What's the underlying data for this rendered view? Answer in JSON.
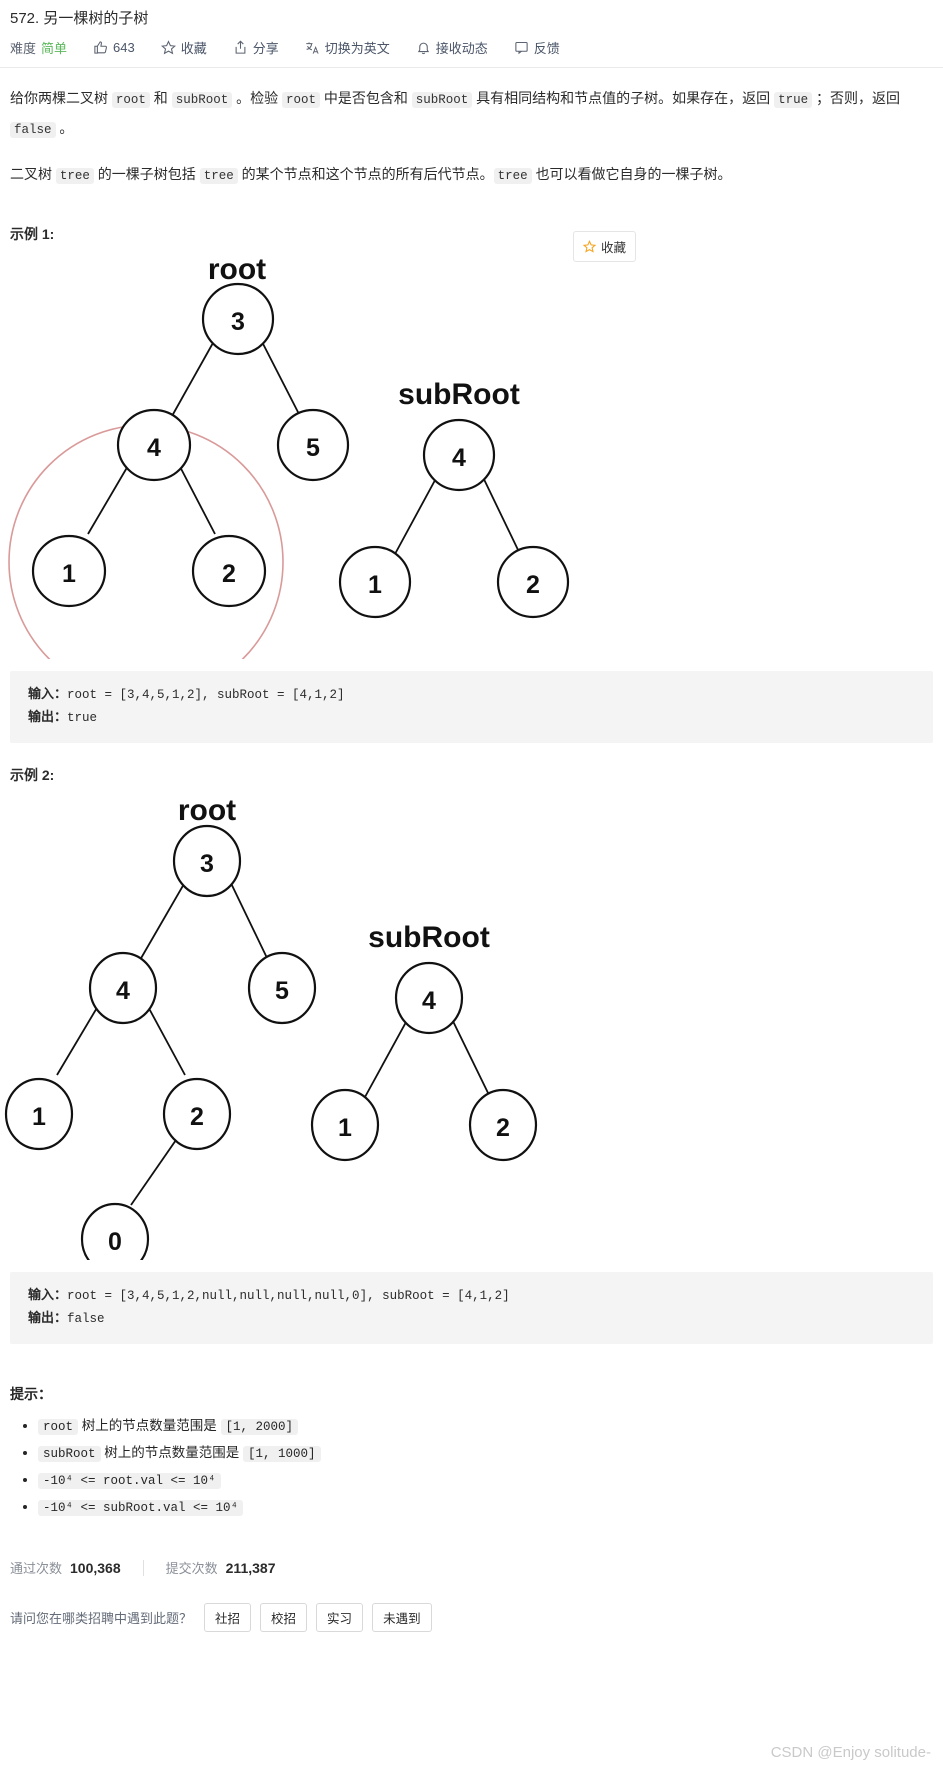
{
  "header": {
    "problem_title": "572. 另一棵树的子树",
    "meta": {
      "difficulty_label": "难度",
      "difficulty_value": "简单",
      "difficulty_color": "#5cb85c",
      "likes_count": "643",
      "favorite_label": "收藏",
      "share_label": "分享",
      "translate_label": "切换为英文",
      "subscribe_label": "接收动态",
      "feedback_label": "反馈"
    }
  },
  "description": {
    "p1_seg1": "给你两棵二叉树 ",
    "p1_code1": "root",
    "p1_seg2": " 和 ",
    "p1_code2": "subRoot",
    "p1_seg3": " 。检验 ",
    "p1_code3": "root",
    "p1_seg4": " 中是否包含和 ",
    "p1_code4": "subRoot",
    "p1_seg5": " 具有相同结构和节点值的子树。如果存在，返回 ",
    "p1_code5": "true",
    "p1_seg6": " ；否则，返回 ",
    "p1_code6": "false",
    "p1_seg7": " 。",
    "p2_seg1": "二叉树 ",
    "p2_code1": "tree",
    "p2_seg2": " 的一棵子树包括 ",
    "p2_code2": "tree",
    "p2_seg3": " 的某个节点和这个节点的所有后代节点。",
    "p2_code3": "tree",
    "p2_seg4": " 也可以看做它自身的一棵子树。"
  },
  "favorite_button": {
    "label": "收藏",
    "icon": "star-icon"
  },
  "example1": {
    "label": "示例 1:",
    "figure": {
      "root_label": "root",
      "subroot_label": "subRoot",
      "root_nodes": [
        "3",
        "4",
        "5",
        "1",
        "2"
      ],
      "subroot_nodes": [
        "4",
        "1",
        "2"
      ],
      "highlight_color": "#d99a9a"
    },
    "input_key": "输入：",
    "input_value": "root = [3,4,5,1,2], subRoot = [4,1,2]",
    "output_key": "输出：",
    "output_value": "true"
  },
  "example2": {
    "label": "示例 2:",
    "figure": {
      "root_label": "root",
      "subroot_label": "subRoot",
      "root_nodes": [
        "3",
        "4",
        "5",
        "1",
        "2",
        "0"
      ],
      "subroot_nodes": [
        "4",
        "1",
        "2"
      ]
    },
    "input_key": "输入：",
    "input_value": "root = [3,4,5,1,2,null,null,null,null,0], subRoot = [4,1,2]",
    "output_key": "输出：",
    "output_value": "false"
  },
  "hints": {
    "title": "提示：",
    "items": [
      {
        "code": "root",
        "text": " 树上的节点数量范围是 ",
        "range": "[1, 2000]"
      },
      {
        "code": "subRoot",
        "text": " 树上的节点数量范围是 ",
        "range": "[1, 1000]"
      }
    ],
    "item3": "-10⁴ <= root.val <= 10⁴",
    "item4": "-10⁴ <= subRoot.val <= 10⁴"
  },
  "footer": {
    "accepted_label": "通过次数",
    "accepted_value": "100,368",
    "submissions_label": "提交次数",
    "submissions_value": "211,387",
    "survey_question": "请问您在哪类招聘中遇到此题？",
    "survey_options": [
      "社招",
      "校招",
      "实习",
      "未遇到"
    ],
    "watermark": "CSDN @Enjoy solitude-"
  }
}
